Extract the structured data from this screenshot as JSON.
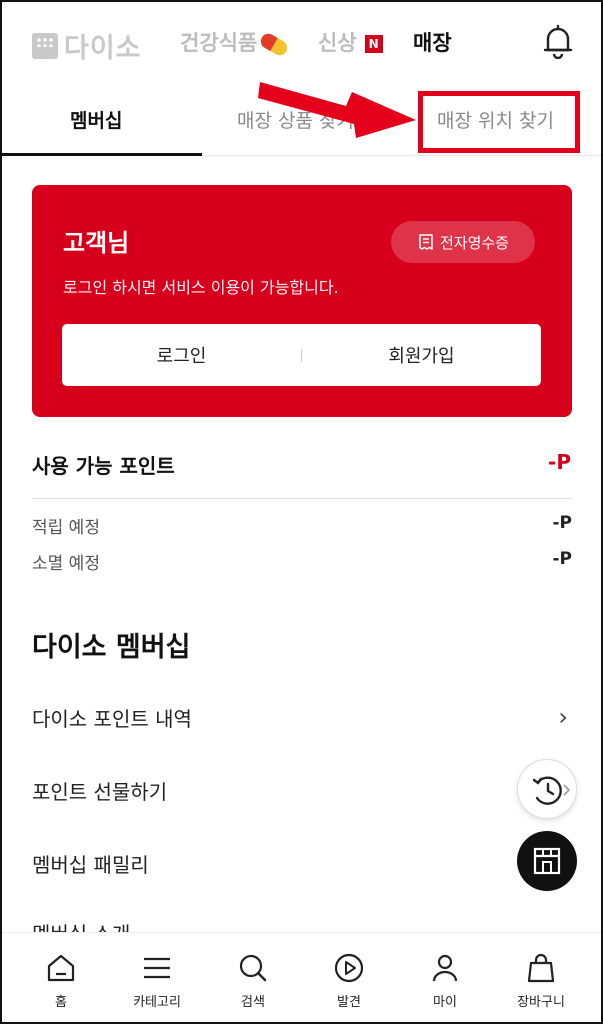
{
  "topnav": {
    "logo_text": "다이소",
    "links": [
      {
        "label": "건강식품"
      },
      {
        "label": "신상",
        "badge": "N"
      },
      {
        "label": "매장"
      }
    ]
  },
  "tabs": [
    "멤버십",
    "매장 상품 찾기",
    "매장 위치 찾기"
  ],
  "card": {
    "title": "고객님",
    "receipt_label": "전자영수증",
    "description": "로그인 하시면 서비스 이용이 가능합니다.",
    "login_label": "로그인",
    "signup_label": "회원가입"
  },
  "points": {
    "title": "사용 가능 포인트",
    "value": "-P",
    "earn_label": "적립 예정",
    "earn_value": "-P",
    "expire_label": "소멸 예정",
    "expire_value": "-P"
  },
  "membership": {
    "title": "다이소 멤버십",
    "items": [
      "다이소 포인트 내역",
      "포인트 선물하기",
      "멤버십 패밀리",
      "멤버십 소개"
    ]
  },
  "bottom_nav": [
    "홈",
    "카테고리",
    "검색",
    "발견",
    "마이",
    "장바구니"
  ],
  "colors": {
    "brand": "#d6001c",
    "annotation": "#e4001b"
  }
}
